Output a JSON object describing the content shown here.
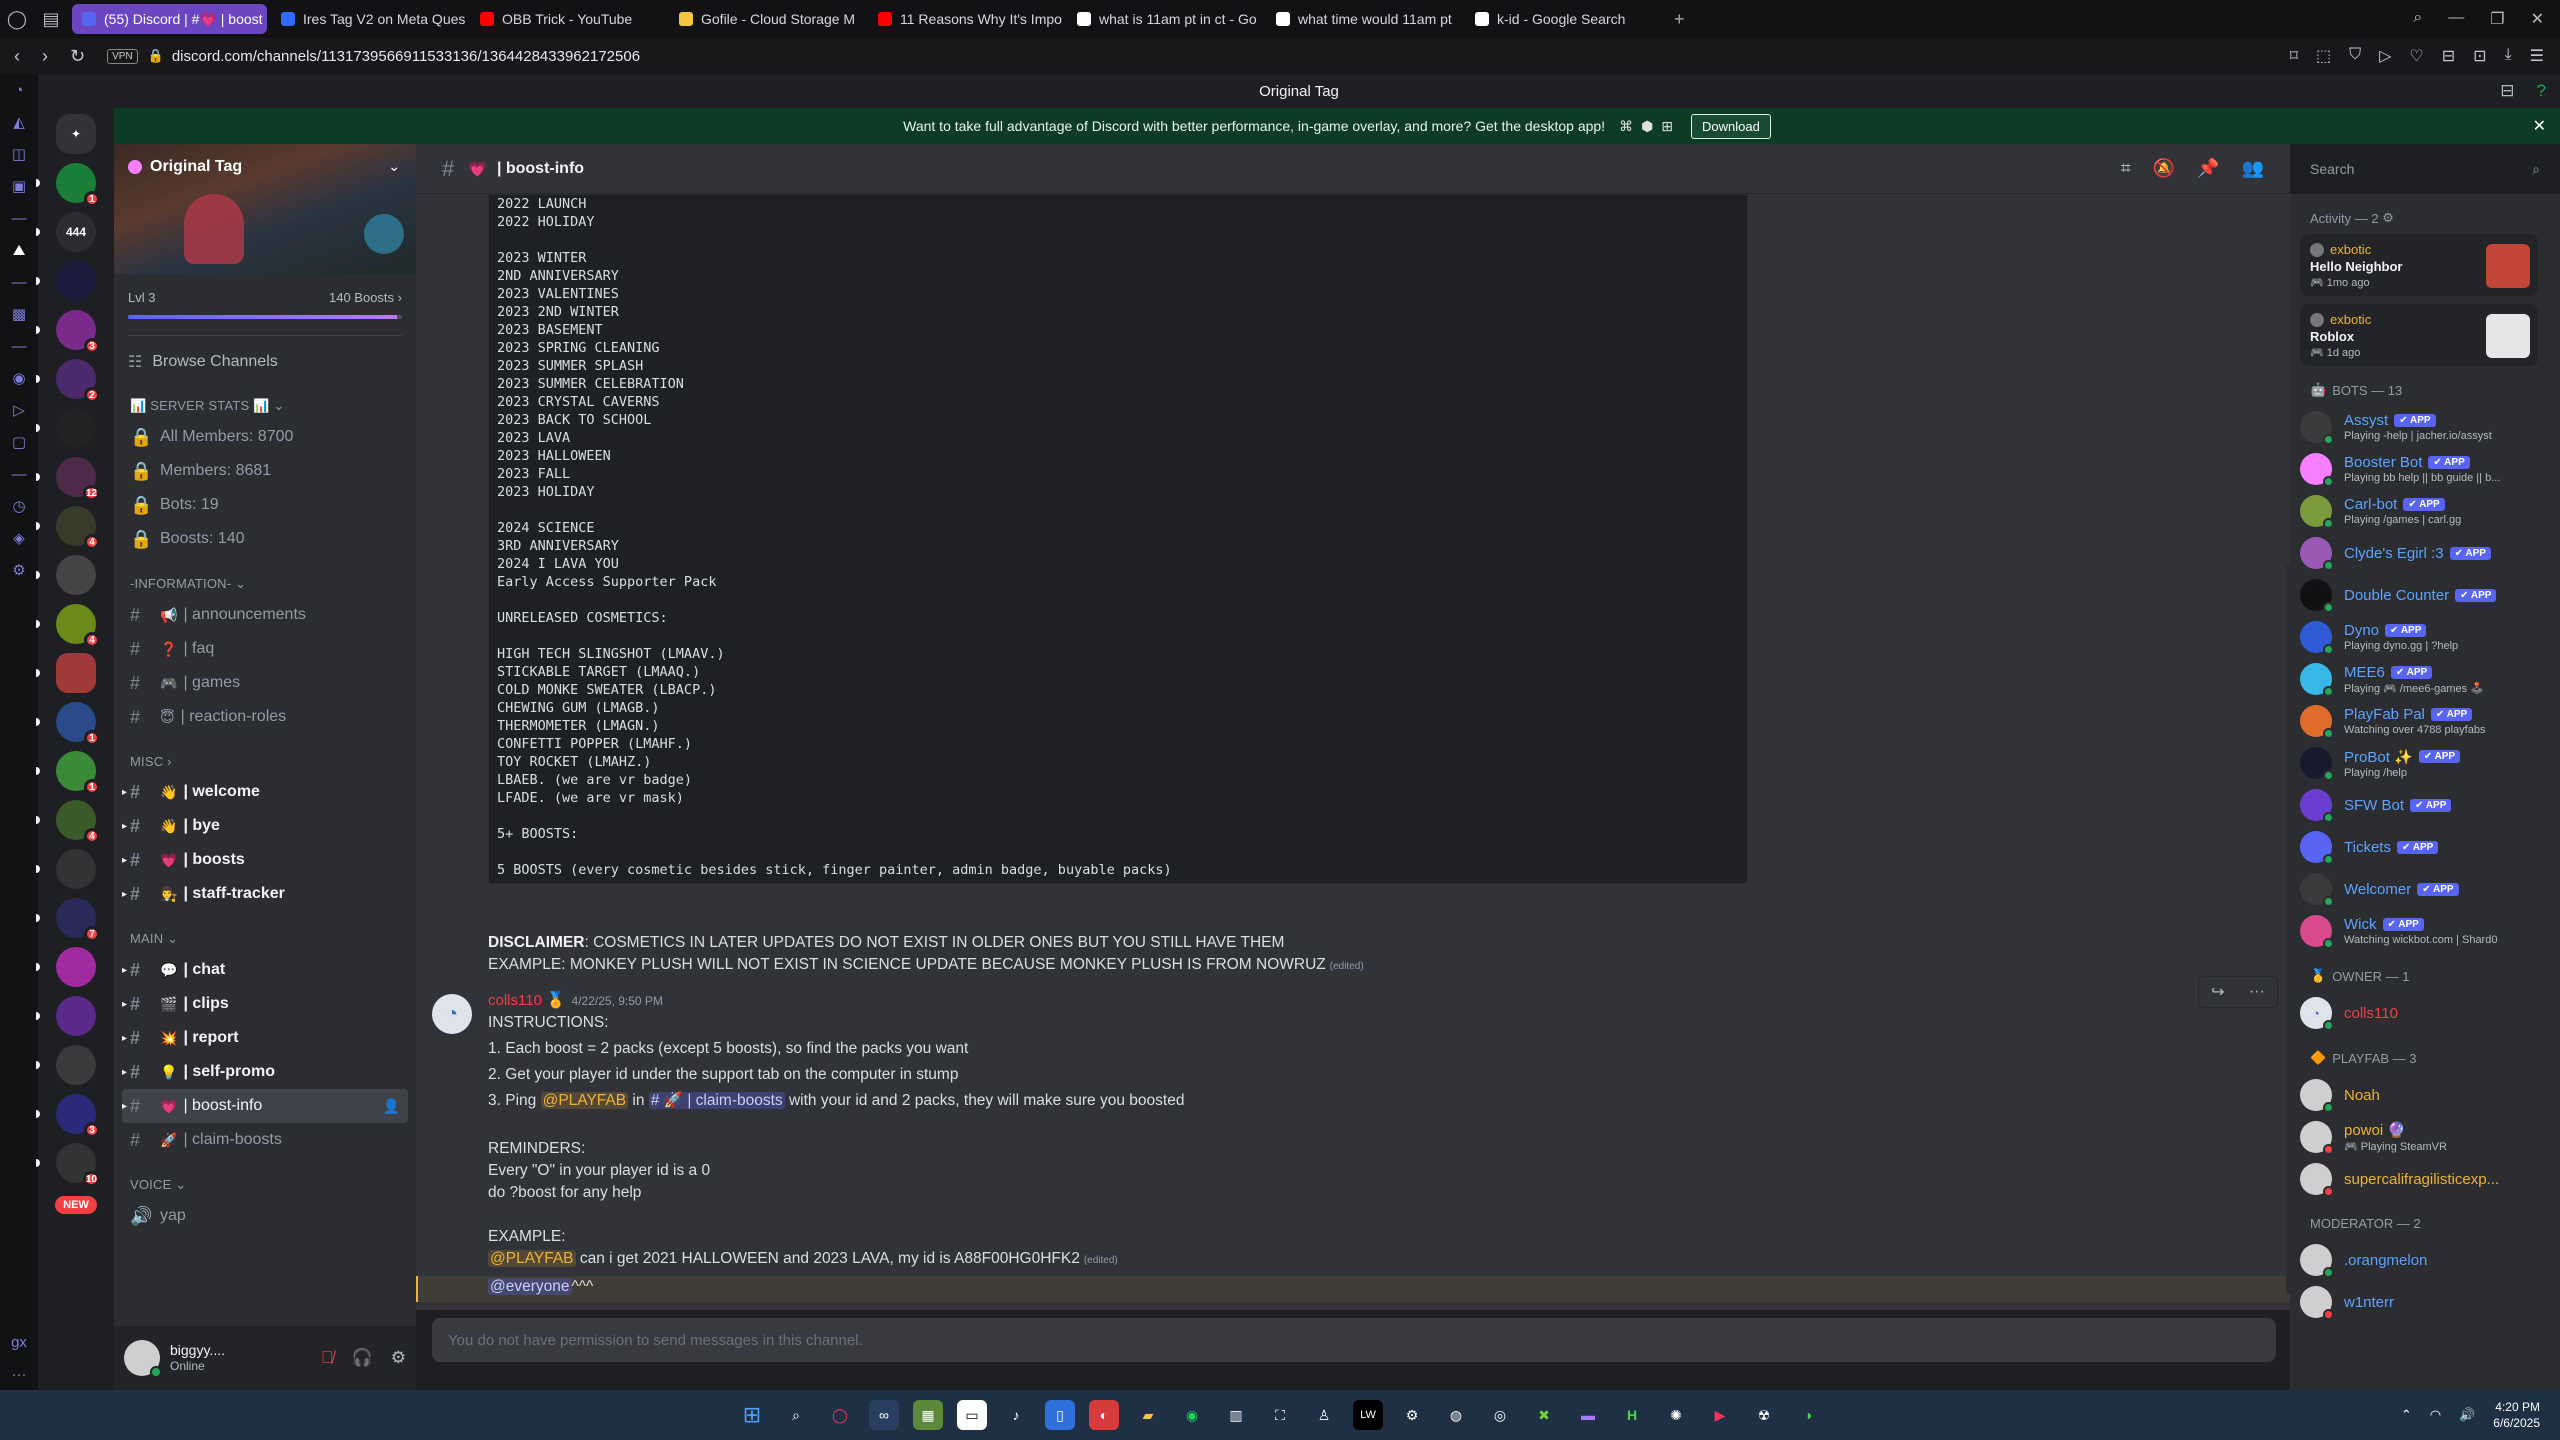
{
  "browser": {
    "tabs": [
      {
        "label": "(55) Discord | #💗 | boost",
        "active": true,
        "fav_color": "#5865f2"
      },
      {
        "label": "Ires Tag V2 on Meta Ques",
        "active": false,
        "fav_color": "#2f6bff"
      },
      {
        "label": "OBB Trick - YouTube",
        "active": false,
        "fav_color": "#ff0000"
      },
      {
        "label": "Gofile - Cloud Storage M",
        "active": false,
        "fav_color": "#f5c542"
      },
      {
        "label": "11 Reasons Why It's Impo",
        "active": false,
        "fav_color": "#ff0000"
      },
      {
        "label": "what is 11am pt in ct - Go",
        "active": false,
        "fav_color": "#ffffff"
      },
      {
        "label": "what time would 11am pt",
        "active": false,
        "fav_color": "#ffffff"
      },
      {
        "label": "k-id - Google Search",
        "active": false,
        "fav_color": "#ffffff"
      }
    ],
    "vpn_label": "VPN",
    "url": "discord.com/channels/1131739566911533136/1364428433962172506"
  },
  "discord": {
    "window_title": "Original Tag",
    "banner": {
      "text": "Want to take full advantage of Discord with better performance, in-game overlay, and more? Get the desktop app!",
      "download_label": "Download"
    },
    "guild_badges": [
      "1",
      "",
      "",
      "3",
      "2",
      "",
      "12",
      "4",
      "",
      "4",
      "",
      "1",
      "1",
      "4",
      "",
      "7",
      "",
      "",
      "",
      "3",
      "10"
    ],
    "guild_labels": [
      "",
      "444",
      "",
      "",
      "",
      "",
      "",
      "",
      "",
      "",
      "",
      "",
      "",
      "",
      "",
      "",
      "",
      "",
      "",
      "",
      ""
    ],
    "new_label": "NEW",
    "server": {
      "name": "Original Tag",
      "level": "Lvl 3",
      "boosts": "140 Boosts",
      "boost_progress": 0.98
    },
    "browse_channels": "Browse Channels",
    "categories": {
      "stats": "📊 SERVER STATS 📊",
      "information": "-INFORMATION-",
      "misc": "MISC",
      "main": "MAIN",
      "voice": "VOICE"
    },
    "stats_channels": [
      "All Members: 8700",
      "Members: 8681",
      "Bots: 19",
      "Boosts: 140"
    ],
    "info_channels": [
      {
        "emoji": "📢",
        "label": "| announcements"
      },
      {
        "emoji": "❓",
        "label": "| faq"
      },
      {
        "emoji": "🎮",
        "label": "| games"
      },
      {
        "emoji": "😇",
        "label": "| reaction-roles"
      }
    ],
    "misc_channels": [
      {
        "emoji": "👋",
        "label": "| welcome"
      },
      {
        "emoji": "👋",
        "label": "| bye"
      },
      {
        "emoji": "💗",
        "label": "| boosts"
      },
      {
        "emoji": "👨‍⚖️",
        "label": "| staff-tracker"
      }
    ],
    "main_channels": [
      {
        "emoji": "💬",
        "label": "| chat"
      },
      {
        "emoji": "🎬",
        "label": "| clips"
      },
      {
        "emoji": "💥",
        "label": "| report"
      },
      {
        "emoji": "💡",
        "label": "| self-promo"
      },
      {
        "emoji": "💗",
        "label": "| boost-info"
      },
      {
        "emoji": "🚀",
        "label": "| claim-boosts"
      }
    ],
    "voice_channels": [
      {
        "label": "yap"
      }
    ],
    "user": {
      "name": "biggyy....",
      "status": "Online"
    },
    "channel": {
      "name": "| boost-info"
    },
    "search_placeholder": "Search",
    "code_lines": [
      "2022 LAUNCH",
      "2022 HOLIDAY",
      "",
      "2023 WINTER",
      "2ND ANNIVERSARY",
      "2023 VALENTINES",
      "2023 2ND WINTER",
      "2023 BASEMENT",
      "2023 SPRING CLEANING",
      "2023 SUMMER SPLASH",
      "2023 SUMMER CELEBRATION",
      "2023 CRYSTAL CAVERNS",
      "2023 BACK TO SCHOOL",
      "2023 LAVA",
      "2023 HALLOWEEN",
      "2023 FALL",
      "2023 HOLIDAY",
      "",
      "2024 SCIENCE",
      "3RD ANNIVERSARY",
      "2024 I LAVA YOU",
      "Early Access Supporter Pack",
      "",
      "UNRELEASED COSMETICS:",
      "",
      "HIGH TECH SLINGSHOT (LMAAV.)",
      "STICKABLE TARGET (LMAAQ.)",
      "COLD MONKE SWEATER (LBACP.)",
      "CHEWING GUM (LMAGB.)",
      "THERMOMETER (LMAGN.)",
      "CONFETTI POPPER (LMAHF.)",
      "TOY ROCKET (LMAHZ.)",
      "LBAEB. (we are vr badge)",
      "LFADE. (we are vr mask)",
      "",
      "5+ BOOSTS:",
      "",
      "5 BOOSTS (every cosmetic besides stick, finger painter, admin badge, buyable packs)"
    ],
    "disclaimer": {
      "label": "DISCLAIMER",
      "text": ": COSMETICS IN LATER UPDATES DO NOT EXIST IN OLDER ONES BUT YOU STILL HAVE THEM",
      "example": "EXAMPLE: MONKEY PLUSH WILL NOT EXIST IN SCIENCE UPDATE BECAUSE MONKEY PLUSH IS FROM NOWRUZ",
      "edited": "(edited)"
    },
    "message": {
      "author": "colls110",
      "timestamp": "4/22/25, 9:50 PM",
      "instructions": "INSTRUCTIONS:",
      "step1": "1. Each boost = 2 packs (except 5 boosts), so find the packs you want",
      "step2": "2. Get your player id under the support tab on the computer in stump",
      "step3_a": "3. Ping",
      "step3_mention": "@PLAYFAB",
      "step3_b": "in",
      "step3_channel": "# 🚀 | claim-boosts",
      "step3_c": "with your id and 2 packs, they will make sure you boosted",
      "reminders": "REMINDERS:",
      "rem1": "Every \"O\" in your player id is a 0",
      "rem2": "do ?boost for any help",
      "example_label": "EXAMPLE:",
      "example_mention": "@PLAYFAB",
      "example_text": "can i get 2021 HALLOWEEN and 2023 LAVA, my id is A88F00HG0HFK2",
      "edited": "(edited)",
      "everyone": "@everyone",
      "everyone_tail": "^^^"
    },
    "input_placeholder": "You do not have permission to send messages in this channel.",
    "members": {
      "activity_label": "Activity — 2",
      "activities": [
        {
          "user": "exbotic",
          "title": "Hello Neighbor",
          "sub": "🎮 1mo ago",
          "thumb_color": "#c2473a"
        },
        {
          "user": "exbotic",
          "title": "Roblox",
          "sub": "🎮 1d ago",
          "thumb_color": "#e6e6e6"
        }
      ],
      "bots_label": "BOTS — 13",
      "bots": [
        {
          "name": "Assyst",
          "status": "Playing -help | jacher.io/assyst",
          "color": "#3b3b3b",
          "st": "on"
        },
        {
          "name": "Booster Bot",
          "status": "Playing bb help || bb guide || b...",
          "color": "#f47fff",
          "st": "on"
        },
        {
          "name": "Carl-bot",
          "status": "Playing /games | carl.gg",
          "color": "#7a9a3b",
          "st": "on"
        },
        {
          "name": "Clyde's Egirl :3",
          "status": "",
          "color": "#9b59b6",
          "st": "on"
        },
        {
          "name": "Double Counter",
          "status": "",
          "color": "#111111",
          "st": "on"
        },
        {
          "name": "Dyno",
          "status": "Playing dyno.gg | ?help",
          "color": "#2f5bd6",
          "st": "on"
        },
        {
          "name": "MEE6",
          "status": "Playing 🎮 /mee6-games 🕹️",
          "color": "#37b8e6",
          "st": "on"
        },
        {
          "name": "PlayFab Pal",
          "status": "Watching over 4788 playfabs",
          "color": "#e06c2b",
          "st": "on"
        },
        {
          "name": "ProBot ✨",
          "status": "Playing /help",
          "color": "#1a1a2e",
          "st": "on"
        },
        {
          "name": "SFW Bot",
          "status": "",
          "color": "#6a3fd0",
          "st": "on"
        },
        {
          "name": "Tickets",
          "status": "",
          "color": "#5865f2",
          "st": "on"
        },
        {
          "name": "Welcomer",
          "status": "",
          "color": "#3a3a3a",
          "st": "on"
        },
        {
          "name": "Wick",
          "status": "Watching wickbot.com | Shard0",
          "color": "#d94a8c",
          "st": "on"
        }
      ],
      "app_tag": "✔ APP",
      "owner_label": "OWNER — 1",
      "owner": {
        "name": "colls110",
        "color": "#dfe4ea"
      },
      "playfab_label": "PLAYFAB — 3",
      "playfab": [
        {
          "name": "Noah",
          "status": "",
          "color": "#cfcfcf",
          "st": "on"
        },
        {
          "name": "powoi 🔮",
          "status": "🎮 Playing SteamVR",
          "color": "#cfcfcf",
          "st": "dnd"
        },
        {
          "name": "supercalifragilisticexp...",
          "status": "",
          "color": "#cfcfcf",
          "st": "dnd"
        }
      ],
      "mod_label": "MODERATOR — 2",
      "mods": [
        {
          "name": ".orangmelon",
          "color": "#cfcfcf",
          "st": "on"
        },
        {
          "name": "w1nterr",
          "color": "#cfcfcf",
          "st": "dnd"
        }
      ]
    }
  },
  "taskbar": {
    "time": "4:20 PM",
    "date": "6/6/2025"
  }
}
